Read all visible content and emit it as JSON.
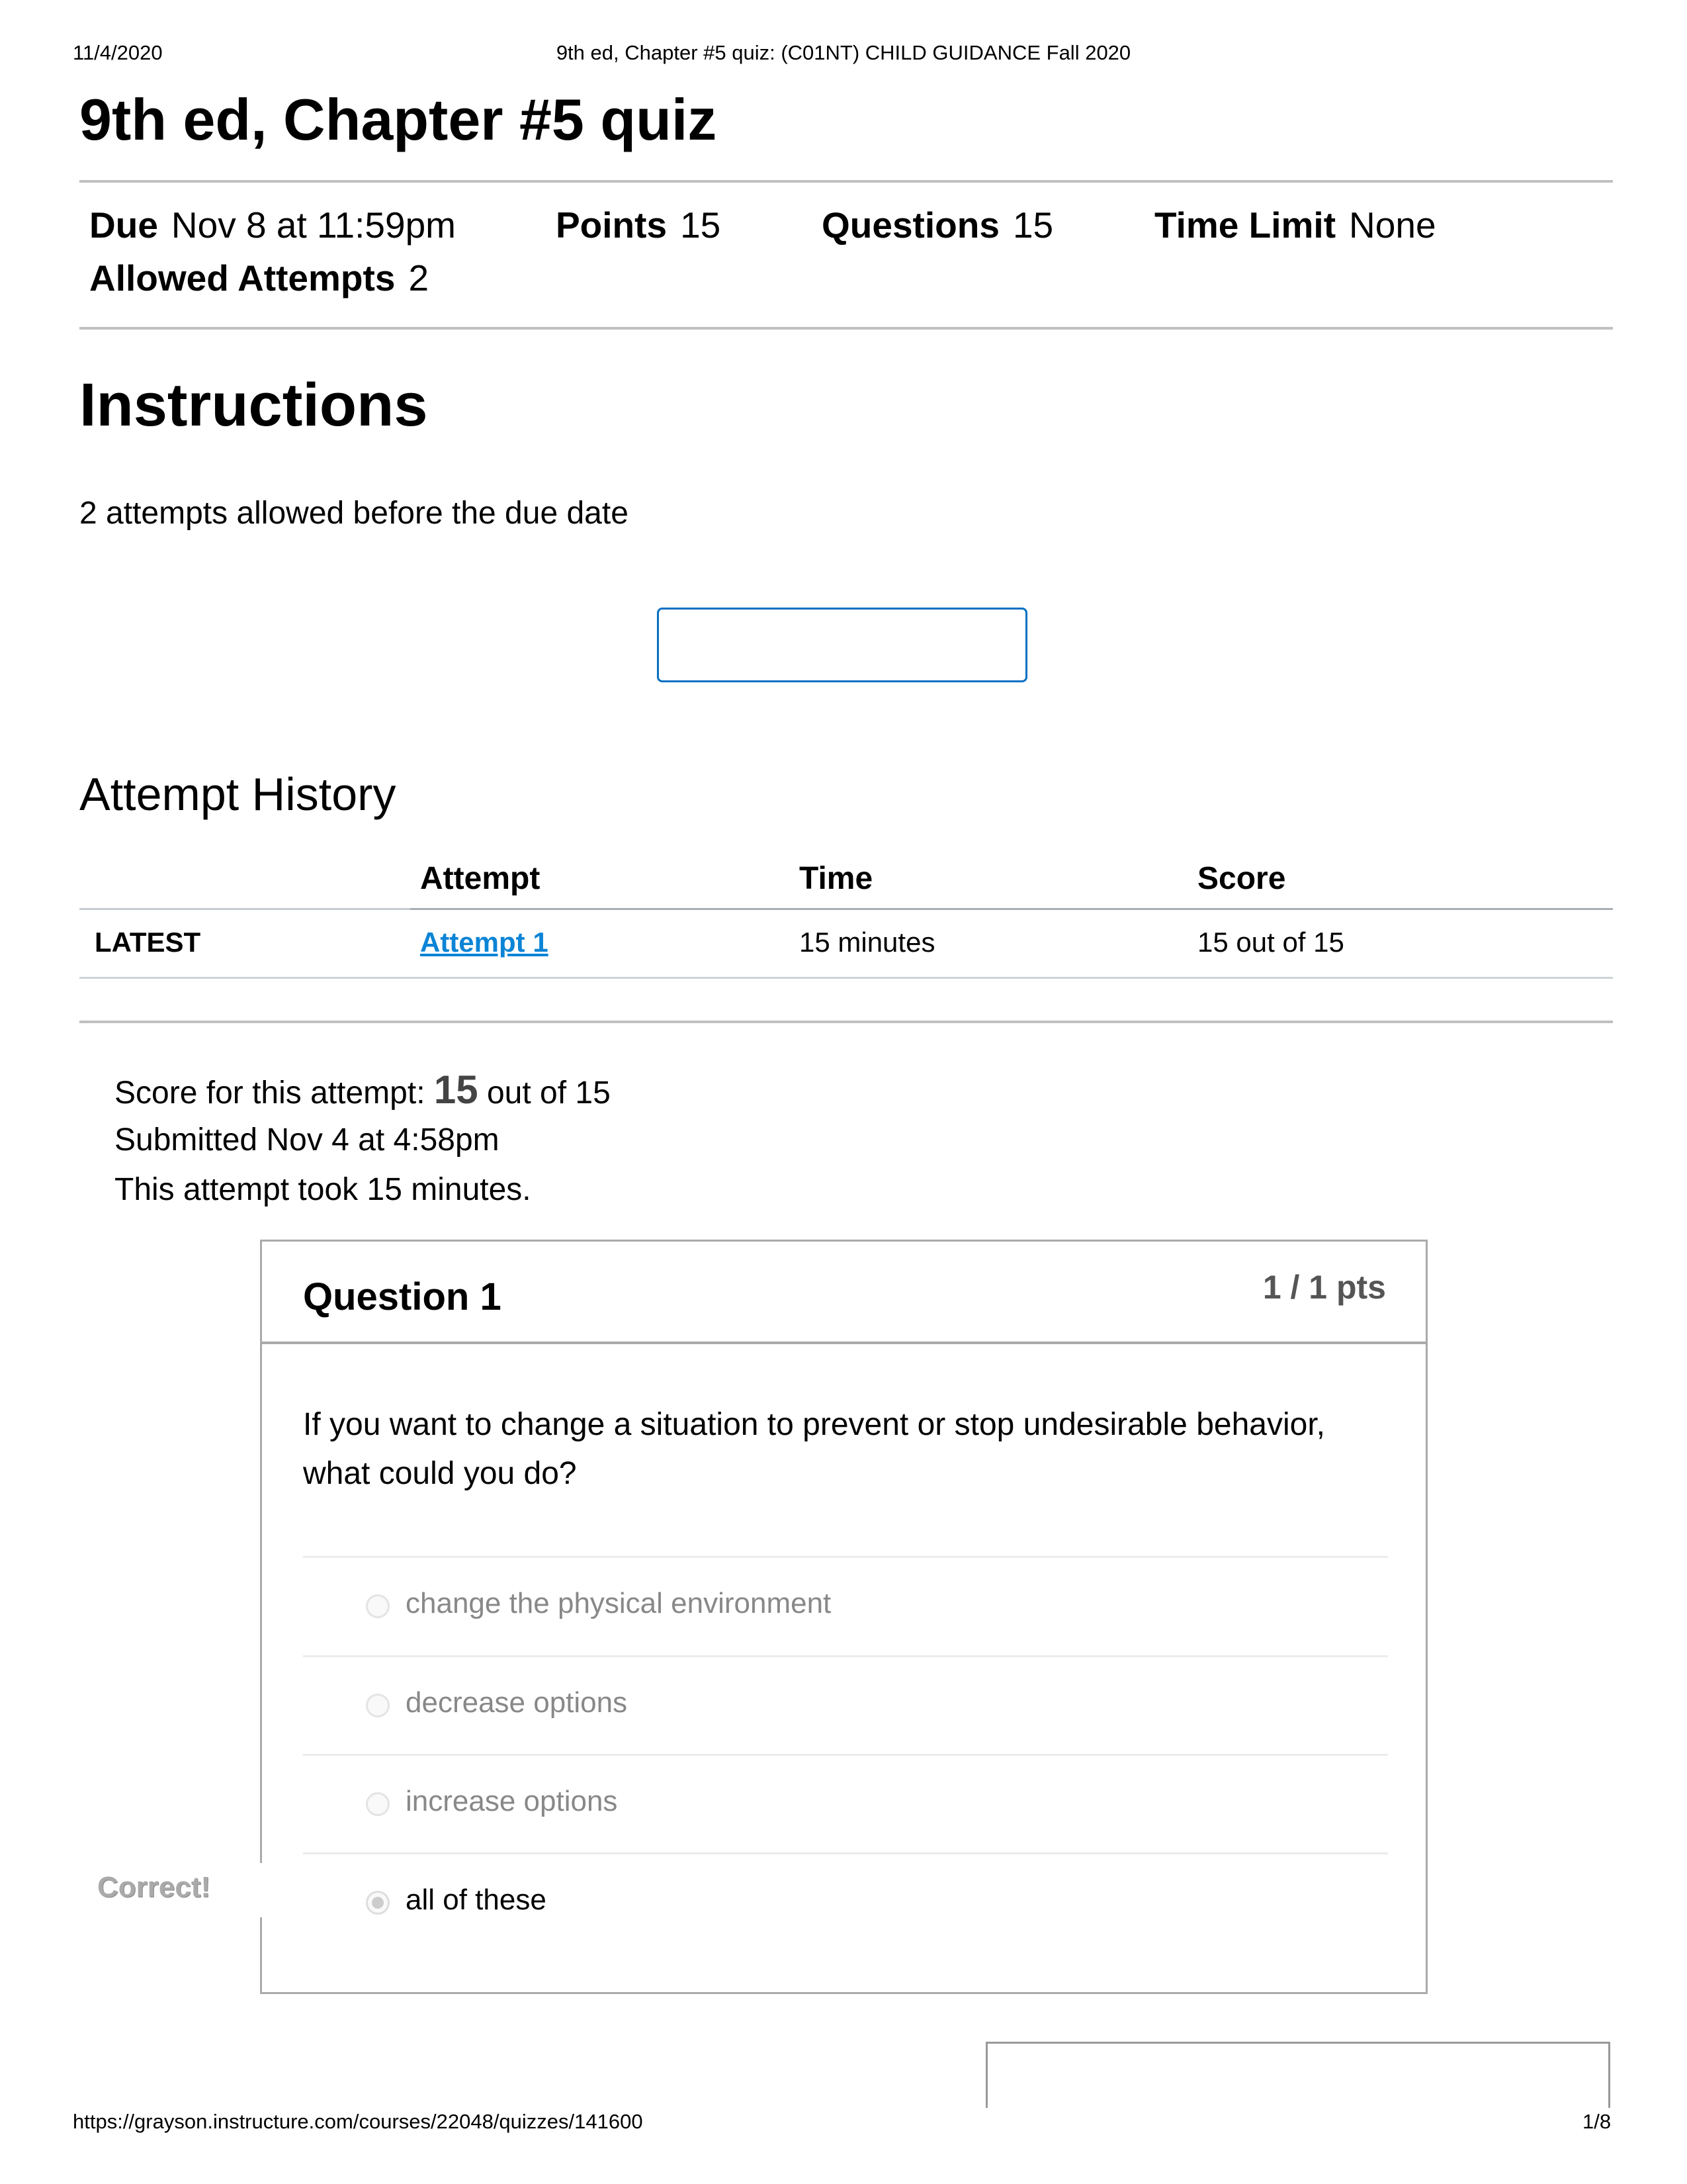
{
  "print_header": {
    "date": "11/4/2020",
    "title": "9th ed, Chapter #5 quiz: (C01NT) CHILD GUIDANCE Fall 2020"
  },
  "quiz": {
    "title": "9th ed, Chapter #5 quiz",
    "meta": {
      "due_label": "Due",
      "due_value": "Nov 8 at 11:59pm",
      "points_label": "Points",
      "points_value": "15",
      "questions_label": "Questions",
      "questions_value": "15",
      "time_limit_label": "Time Limit",
      "time_limit_value": "None",
      "attempts_label": "Allowed Attempts",
      "attempts_value": "2"
    },
    "instructions_heading": "Instructions",
    "instructions_text": "2 attempts allowed before the due date",
    "take_quiz_button_label": ""
  },
  "attempt_history": {
    "heading": "Attempt History",
    "columns": [
      "",
      "Attempt",
      "Time",
      "Score"
    ],
    "rows": [
      {
        "tag": "LATEST",
        "attempt": "Attempt 1 ",
        "time": "15 minutes",
        "score": "15 out of 15"
      }
    ]
  },
  "attempt_summary": {
    "score_prefix": "Score for this attempt: ",
    "score_value": "15",
    "score_suffix": " out of 15",
    "submitted": "Submitted Nov 4 at 4:58pm",
    "duration": "This attempt took 15 minutes."
  },
  "questions": [
    {
      "name": "Question 1",
      "points": "1 / 1 pts",
      "text": "If you want to change a situation to prevent or stop undesirable behavior, what could you do?",
      "answers": [
        {
          "label": "change the physical environment",
          "selected": false
        },
        {
          "label": "decrease options",
          "selected": false
        },
        {
          "label": "increase options",
          "selected": false
        },
        {
          "label": "all of these",
          "selected": true
        }
      ],
      "feedback": "Correct!"
    }
  ],
  "print_footer": {
    "url": "https://grayson.instructure.com/courses/22048/quizzes/141600",
    "page": "1/8"
  },
  "colors": {
    "link": "#0b84d6",
    "button_border": "#0770c2",
    "border": "#aaaaaa"
  }
}
